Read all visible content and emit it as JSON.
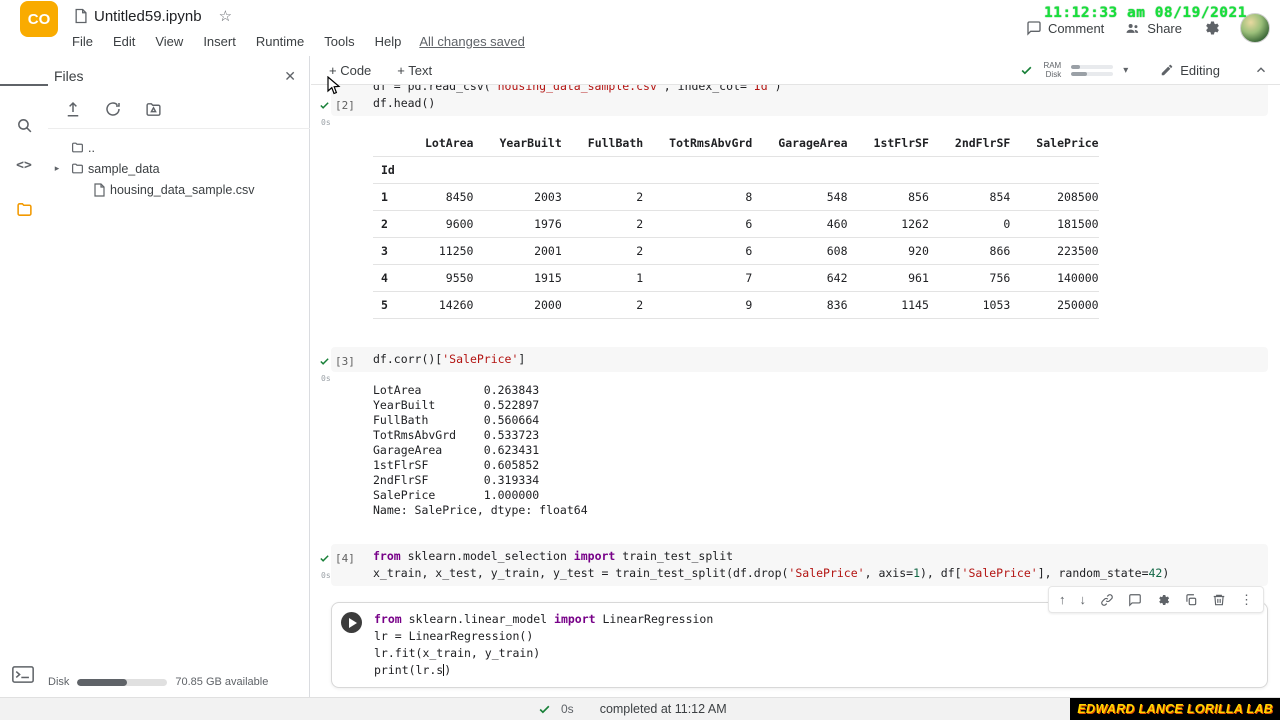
{
  "header": {
    "logo_text": "CO",
    "title": "Untitled59.ipynb",
    "star": "☆",
    "menu_items": [
      "File",
      "Edit",
      "View",
      "Insert",
      "Runtime",
      "Tools",
      "Help"
    ],
    "autosave_status": "All changes saved",
    "clock_overlay": "11:12:33 am 08/19/2021",
    "comment_label": "Comment",
    "share_label": "Share"
  },
  "toolbar": {
    "add_code_label": "+ Code",
    "add_text_label": "+ Text",
    "ram_label": "RAM",
    "disk_label": "Disk",
    "caret": "▾",
    "editing_label": "Editing"
  },
  "files_panel": {
    "title": "Files",
    "close": "✕",
    "expand_arrow": "▸",
    "items": [
      {
        "label": ".."
      },
      {
        "label": "sample_data"
      },
      {
        "label": "housing_data_sample.csv"
      }
    ],
    "disk_label": "Disk",
    "disk_available": "70.85 GB available"
  },
  "cells": {
    "cell1": {
      "exec_count": "[2]",
      "exec_time": "0s",
      "code": [
        [
          {
            "t": "p",
            "s": "df = pd.read_csv("
          },
          {
            "t": "s",
            "s": "'housing_data_sample.csv'"
          },
          {
            "t": "p",
            "s": ", index_col="
          },
          {
            "t": "s",
            "s": "'Id'"
          },
          {
            "t": "p",
            "s": ")"
          }
        ],
        [
          {
            "t": "p",
            "s": "df.head()"
          }
        ]
      ],
      "table": {
        "columns": [
          "LotArea",
          "YearBuilt",
          "FullBath",
          "TotRmsAbvGrd",
          "GarageArea",
          "1stFlrSF",
          "2ndFlrSF",
          "SalePrice"
        ],
        "index_label": "Id",
        "rows": [
          {
            "index": "1",
            "values": [
              "8450",
              "2003",
              "2",
              "8",
              "548",
              "856",
              "854",
              "208500"
            ]
          },
          {
            "index": "2",
            "values": [
              "9600",
              "1976",
              "2",
              "6",
              "460",
              "1262",
              "0",
              "181500"
            ]
          },
          {
            "index": "3",
            "values": [
              "11250",
              "2001",
              "2",
              "6",
              "608",
              "920",
              "866",
              "223500"
            ]
          },
          {
            "index": "4",
            "values": [
              "9550",
              "1915",
              "1",
              "7",
              "642",
              "961",
              "756",
              "140000"
            ]
          },
          {
            "index": "5",
            "values": [
              "14260",
              "2000",
              "2",
              "9",
              "836",
              "1145",
              "1053",
              "250000"
            ]
          }
        ]
      }
    },
    "cell2": {
      "exec_count": "[3]",
      "exec_time": "0s",
      "code": [
        [
          {
            "t": "p",
            "s": "df.corr()["
          },
          {
            "t": "s",
            "s": "'SalePrice'"
          },
          {
            "t": "p",
            "s": "]"
          }
        ]
      ],
      "output_lines": [
        "LotArea         0.263843",
        "YearBuilt       0.522897",
        "FullBath        0.560664",
        "TotRmsAbvGrd    0.533723",
        "GarageArea      0.623431",
        "1stFlrSF        0.605852",
        "2ndFlrSF        0.319334",
        "SalePrice       1.000000",
        "Name: SalePrice, dtype: float64"
      ]
    },
    "cell3": {
      "exec_count": "[4]",
      "exec_time": "0s",
      "code": [
        [
          {
            "t": "k",
            "s": "from"
          },
          {
            "t": "p",
            "s": " sklearn.model_selection "
          },
          {
            "t": "k",
            "s": "import"
          },
          {
            "t": "p",
            "s": " train_test_split"
          }
        ],
        [
          {
            "t": "p",
            "s": "x_train, x_test, y_train, y_test = train_test_split(df.drop("
          },
          {
            "t": "s",
            "s": "'SalePrice'"
          },
          {
            "t": "p",
            "s": ", axis="
          },
          {
            "t": "n",
            "s": "1"
          },
          {
            "t": "p",
            "s": "), df["
          },
          {
            "t": "s",
            "s": "'SalePrice'"
          },
          {
            "t": "p",
            "s": "], random_state="
          },
          {
            "t": "n",
            "s": "42"
          },
          {
            "t": "p",
            "s": ")"
          }
        ]
      ]
    },
    "cell4": {
      "code": [
        [
          {
            "t": "k",
            "s": "from"
          },
          {
            "t": "p",
            "s": " sklearn.linear_model "
          },
          {
            "t": "k",
            "s": "import"
          },
          {
            "t": "p",
            "s": " LinearRegression"
          }
        ],
        [
          {
            "t": "p",
            "s": "lr = LinearRegression()"
          }
        ],
        [
          {
            "t": "p",
            "s": "lr.fit(x_train, y_train)"
          }
        ],
        [
          {
            "t": "p",
            "s": "print(lr.s"
          },
          {
            "t": "cur",
            "s": ""
          },
          {
            "t": "p",
            "s": ")"
          }
        ]
      ]
    }
  },
  "status_bar": {
    "exec_time": "0s",
    "completed": "completed at 11:12 AM"
  },
  "watermark": "EDWARD LANCE LORILLA LAB",
  "colors": {
    "accent_orange": "#f9ab00",
    "check_green": "#188038",
    "clock_green": "#17e13b"
  }
}
